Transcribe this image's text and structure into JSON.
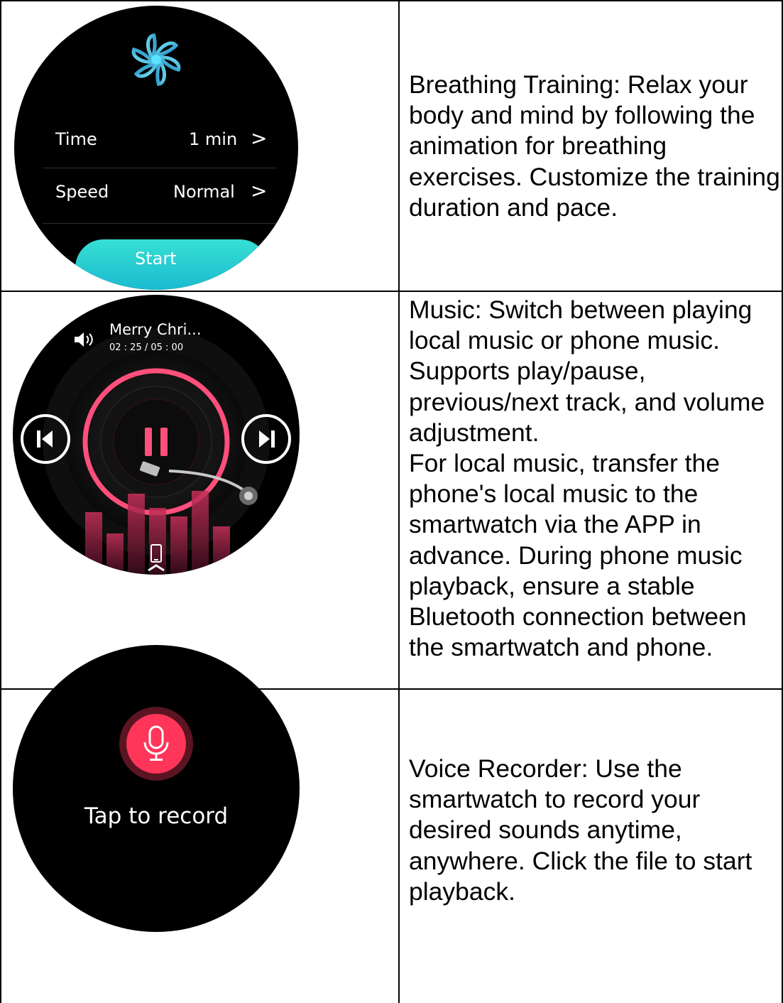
{
  "rows": [
    {
      "watch": {
        "time_label": "Time",
        "time_value": "1 min",
        "speed_label": "Speed",
        "speed_value": "Normal",
        "start_label": "Start",
        "icon": "breathing-flower-icon",
        "chevron": ">"
      },
      "description": [
        "Breathing Training: Relax your body and mind by following the animation for breathing exercises. Customize the training duration and pace."
      ]
    },
    {
      "watch": {
        "track_title": "Merry Chri...",
        "track_time": "02 : 25 / 05 : 00",
        "icons": [
          "volume-icon",
          "previous-track-icon",
          "pause-icon",
          "next-track-icon",
          "phone-source-icon",
          "swipe-up-icon"
        ]
      },
      "description": [
        "Music: Switch between playing local music or phone music. Supports play/pause, previous/next track, and volume adjustment.",
        "For local music, transfer the phone's local music to the smartwatch via the APP in advance. During phone music playback, ensure a stable Bluetooth connection between the smartwatch and phone."
      ]
    },
    {
      "watch": {
        "record_label": "Tap to record",
        "icon": "microphone-icon"
      },
      "description": [
        "Voice Recorder: Use the smartwatch to record your desired sounds anytime, anywhere. Click the file to start playback."
      ]
    }
  ],
  "colors": {
    "accent_teal": "#22c6d4",
    "accent_pink": "#ff3d6e",
    "record_red": "#ff3559"
  }
}
